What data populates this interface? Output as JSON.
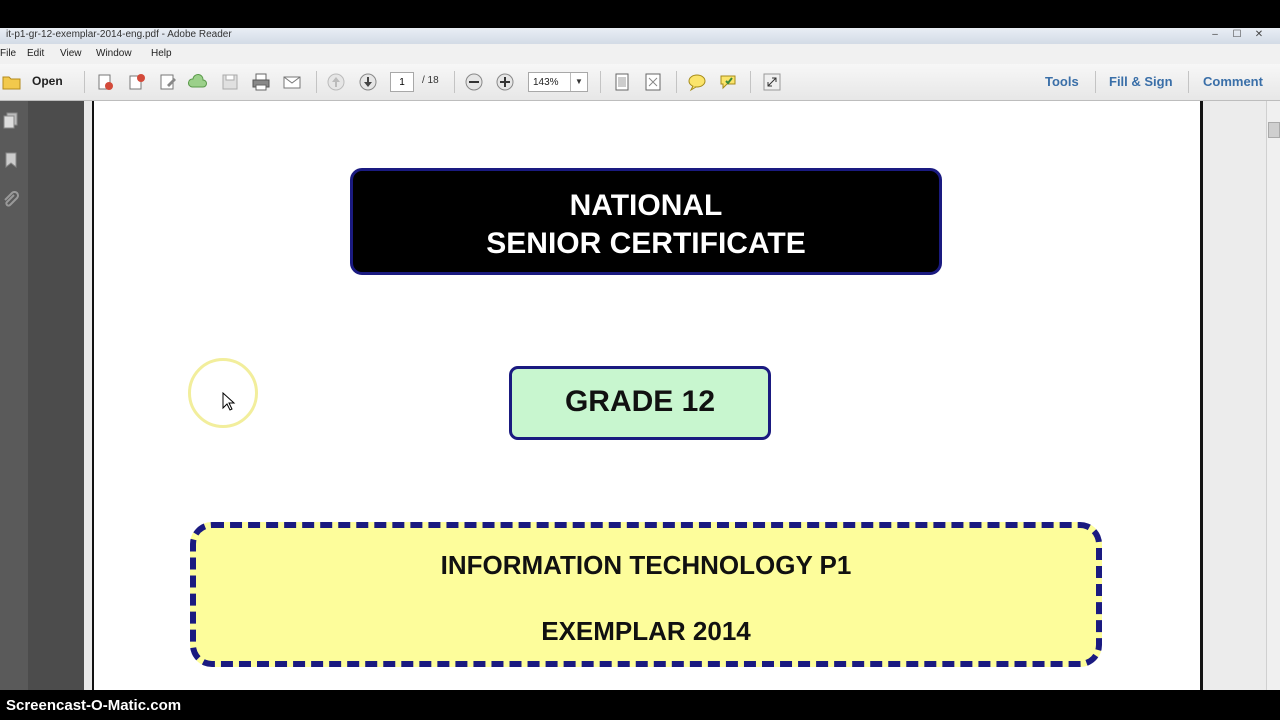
{
  "window": {
    "title": "it-p1-gr-12-exemplar-2014-eng.pdf - Adobe Reader",
    "controls": [
      "–",
      "☐",
      "✕"
    ]
  },
  "menu": {
    "items": [
      "File",
      "Edit",
      "View",
      "Window",
      "Help"
    ]
  },
  "toolbar": {
    "open_label": "Open",
    "page_current": "1",
    "page_total": "/ 18",
    "zoom": "143%",
    "tools_label": "Tools",
    "fill_sign_label": "Fill & Sign",
    "comment_label": "Comment"
  },
  "document": {
    "heading_line1": "NATIONAL",
    "heading_line2": "SENIOR CERTIFICATE",
    "grade": "GRADE 12",
    "subject": "INFORMATION TECHNOLOGY P1",
    "exemplar": "EXEMPLAR 2014"
  },
  "watermark": "Screencast-O-Matic.com",
  "colors": {
    "box_border": "#1a1a80",
    "grade_fill": "#c8f6cf",
    "subject_fill": "#fdfd9b",
    "toolbar_link": "#3a6fa8"
  }
}
